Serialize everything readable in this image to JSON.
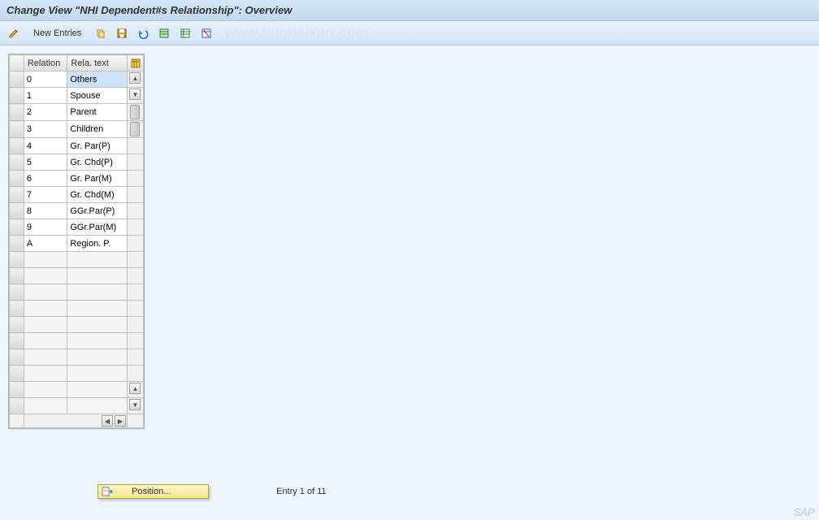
{
  "title": "Change View \"NHI Dependent#s Relationship\": Overview",
  "toolbar": {
    "new_entries_label": "New Entries"
  },
  "watermark": "www.tutorialkart.com",
  "table": {
    "headers": {
      "relation": "Relation",
      "rela_text": "Rela. text"
    },
    "rows": [
      {
        "relation": "0",
        "text": "Others"
      },
      {
        "relation": "1",
        "text": "Spouse"
      },
      {
        "relation": "2",
        "text": "Parent"
      },
      {
        "relation": "3",
        "text": "Children"
      },
      {
        "relation": "4",
        "text": "Gr. Par(P)"
      },
      {
        "relation": "5",
        "text": "Gr. Chd(P)"
      },
      {
        "relation": "6",
        "text": "Gr. Par(M)"
      },
      {
        "relation": "7",
        "text": "Gr. Chd(M)"
      },
      {
        "relation": "8",
        "text": "GGr.Par(P)"
      },
      {
        "relation": "9",
        "text": "GGr.Par(M)"
      },
      {
        "relation": "A",
        "text": "Region. P."
      },
      {
        "relation": "",
        "text": ""
      },
      {
        "relation": "",
        "text": ""
      },
      {
        "relation": "",
        "text": ""
      },
      {
        "relation": "",
        "text": ""
      },
      {
        "relation": "",
        "text": ""
      },
      {
        "relation": "",
        "text": ""
      },
      {
        "relation": "",
        "text": ""
      },
      {
        "relation": "",
        "text": ""
      },
      {
        "relation": "",
        "text": ""
      },
      {
        "relation": "",
        "text": ""
      }
    ],
    "selected_row": 0
  },
  "footer": {
    "position_label": "Position...",
    "entry_status": "Entry 1 of 11"
  },
  "logo": "SAP"
}
